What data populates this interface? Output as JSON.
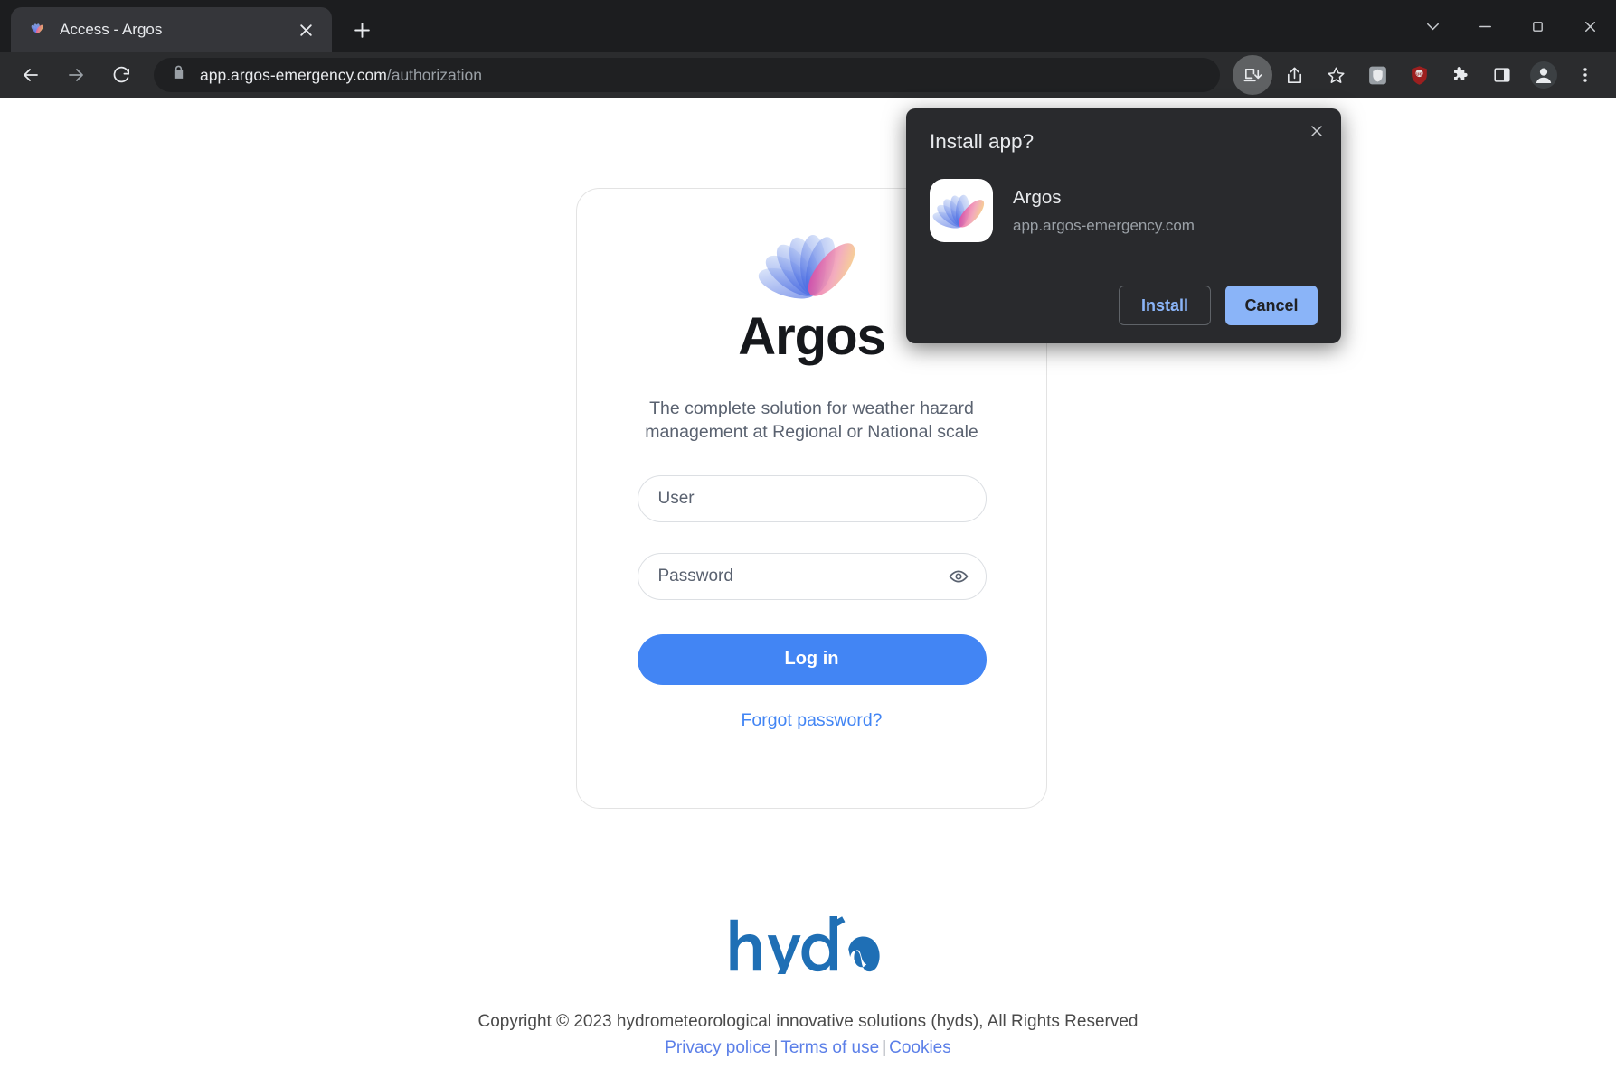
{
  "browser": {
    "tab": {
      "title": "Access - Argos",
      "favicon_icon": "argos-flower-icon",
      "close_icon": "close-icon"
    },
    "new_tab_icon": "plus-icon",
    "window_controls": {
      "tab_search_icon": "chevron-down-icon",
      "minimize_icon": "minimize-icon",
      "maximize_icon": "maximize-icon",
      "close_icon": "close-icon"
    },
    "nav": {
      "back_icon": "arrow-left-icon",
      "forward_icon": "arrow-right-icon",
      "reload_icon": "reload-icon"
    },
    "omnibox": {
      "lock_icon": "lock-icon",
      "host": "app.argos-emergency.com",
      "path": "/authorization"
    },
    "actions": [
      {
        "name": "install-app-icon",
        "icon": "install-app-icon",
        "active": true
      },
      {
        "name": "share-icon",
        "icon": "share-icon",
        "active": false
      },
      {
        "name": "bookmark-star-icon",
        "icon": "star-icon",
        "active": false
      },
      {
        "name": "extension-shield-icon",
        "icon": "shield-icon",
        "active": false
      },
      {
        "name": "ublock-origin-icon",
        "icon": "ublock-icon",
        "active": false
      },
      {
        "name": "extensions-puzzle-icon",
        "icon": "puzzle-icon",
        "active": false
      },
      {
        "name": "side-panel-icon",
        "icon": "side-panel-icon",
        "active": false
      },
      {
        "name": "profile-avatar-icon",
        "icon": "person-icon",
        "active": false
      },
      {
        "name": "chrome-menu-icon",
        "icon": "three-dots-icon",
        "active": false
      }
    ]
  },
  "login": {
    "brand_name": "Argos",
    "brand_logo_icon": "argos-flower-logo",
    "tagline": "The complete solution for weather hazard management at Regional or National scale",
    "user_field": {
      "placeholder": "User",
      "value": ""
    },
    "password_field": {
      "placeholder": "Password",
      "value": "",
      "toggle_icon": "eye-icon"
    },
    "login_button": "Log in",
    "forgot_link": "Forgot password?"
  },
  "footer": {
    "logo_text": "hyds",
    "logo_icon": "hyds-wave-logo",
    "copyright": "Copyright © 2023 hydrometeorological innovative solutions (hyds), All Rights Reserved",
    "links": [
      {
        "label": "Privacy police"
      },
      {
        "label": "Terms of use"
      },
      {
        "label": "Cookies"
      }
    ],
    "separator": "|"
  },
  "install_dialog": {
    "title": "Install app?",
    "app_name": "Argos",
    "app_origin": "app.argos-emergency.com",
    "app_icon": "argos-flower-icon",
    "close_icon": "close-icon",
    "install_label": "Install",
    "cancel_label": "Cancel"
  },
  "colors": {
    "accent_blue": "#4285f4",
    "link_blue": "#5b7fe8",
    "chrome_blue": "#8ab4f8",
    "chrome_bg": "#2b2c2e",
    "tabstrip_bg": "#1c1d1f",
    "dialog_bg": "#292a2d",
    "hyds_blue": "#1f6fb5"
  }
}
